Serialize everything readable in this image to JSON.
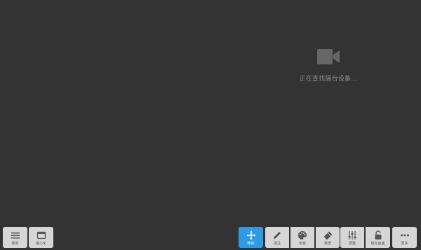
{
  "status": {
    "message": "正在查找摄台设备...",
    "icon": "video-camera-icon"
  },
  "toolbar": {
    "menu": {
      "label": "菜单",
      "icon": "hamburger-menu-icon"
    },
    "minimize": {
      "label": "最小化",
      "icon": "window-minimize-icon"
    },
    "move": {
      "label": "移动",
      "icon": "move-arrows-icon",
      "active": true
    },
    "annotate": {
      "label": "批注",
      "icon": "pencil-icon"
    },
    "color": {
      "label": "色板",
      "icon": "palette-icon"
    },
    "eraser": {
      "label": "橡皮",
      "icon": "eraser-icon"
    },
    "adjust": {
      "label": "调整",
      "icon": "sliders-icon"
    },
    "lock": {
      "label": "锁定画面",
      "icon": "unlock-icon"
    },
    "more": {
      "label": "更多",
      "icon": "more-dots-icon"
    }
  },
  "colors": {
    "background": "#333333",
    "button": "#d6d6d6",
    "active": "#2f9be3",
    "status_text": "#8a8a8a",
    "camera_icon": "#666666"
  }
}
